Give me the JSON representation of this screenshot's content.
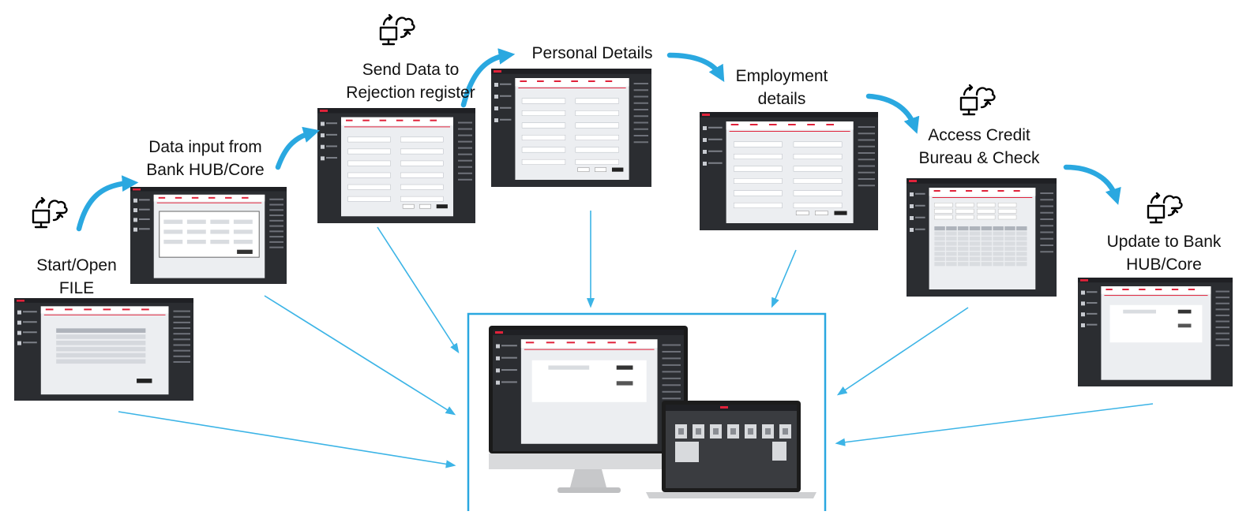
{
  "steps": [
    {
      "label": "Start/Open\nFILE",
      "icon": "computer-cloud-sync-icon"
    },
    {
      "label": "Data input from\nBank HUB/Core"
    },
    {
      "label": "Send Data to\nRejection register",
      "icon": "computer-cloud-sync-icon"
    },
    {
      "label": "Personal Details"
    },
    {
      "label": "Employment\ndetails"
    },
    {
      "label": "Access Credit\nBureau & Check",
      "icon": "computer-cloud-sync-icon"
    },
    {
      "label": "Update to Bank\nHUB/Core",
      "icon": "computer-cloud-sync-icon"
    }
  ],
  "colors": {
    "arrow": "#2aa8e0",
    "connector": "#3cb4e6",
    "frame": "#2aa8e0",
    "app_dark": "#2b2d31",
    "app_light": "#eceef1",
    "accent": "#e0223a"
  }
}
